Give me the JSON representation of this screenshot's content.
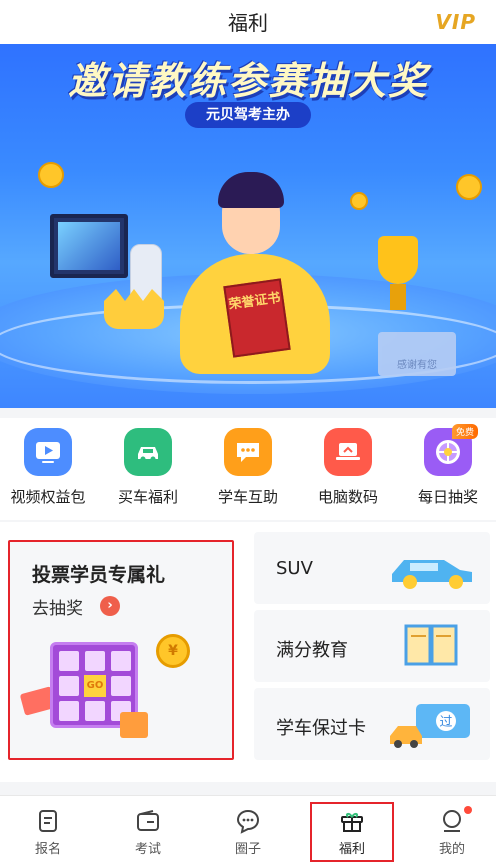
{
  "header": {
    "title": "福利",
    "vip_label": "VIP"
  },
  "banner": {
    "title": "邀请教练参赛抽大奖",
    "subtitle": "元贝驾考主办",
    "book_text": "荣誉证书",
    "card_text": "感谢有您"
  },
  "categories": [
    {
      "label": "视频权益包",
      "icon": "video-play-icon",
      "color": "#4d8dff"
    },
    {
      "label": "买车福利",
      "icon": "car-icon",
      "color": "#2ebd7e"
    },
    {
      "label": "学车互助",
      "icon": "chat-bubble-icon",
      "color": "#ff9f1a"
    },
    {
      "label": "电脑数码",
      "icon": "laptop-icon",
      "color": "#ff5a4a"
    },
    {
      "label": "每日抽奖",
      "icon": "lottery-wheel-icon",
      "color": "#9a5cf5",
      "badge": "免费"
    }
  ],
  "promo": {
    "title": "投票学员专属礼",
    "action": "去抽奖",
    "grid_label": "GO",
    "coin_label": "¥"
  },
  "side_cards": [
    {
      "label": "SUV",
      "icon": "suv-car-icon"
    },
    {
      "label": "满分教育",
      "icon": "open-book-icon"
    },
    {
      "label": "学车保过卡",
      "icon": "pass-card-icon",
      "pass_text": "过"
    }
  ],
  "nav": {
    "items": [
      {
        "label": "报名",
        "icon": "document-icon"
      },
      {
        "label": "考试",
        "icon": "wallet-icon"
      },
      {
        "label": "圈子",
        "icon": "chat-icon"
      },
      {
        "label": "福利",
        "icon": "gift-icon",
        "active": true
      },
      {
        "label": "我的",
        "icon": "profile-icon",
        "has_dot": true
      }
    ]
  },
  "colors": {
    "accent_red": "#e5242b",
    "vip_gold": "#e6a623",
    "banner_blue": "#3a8bff"
  }
}
